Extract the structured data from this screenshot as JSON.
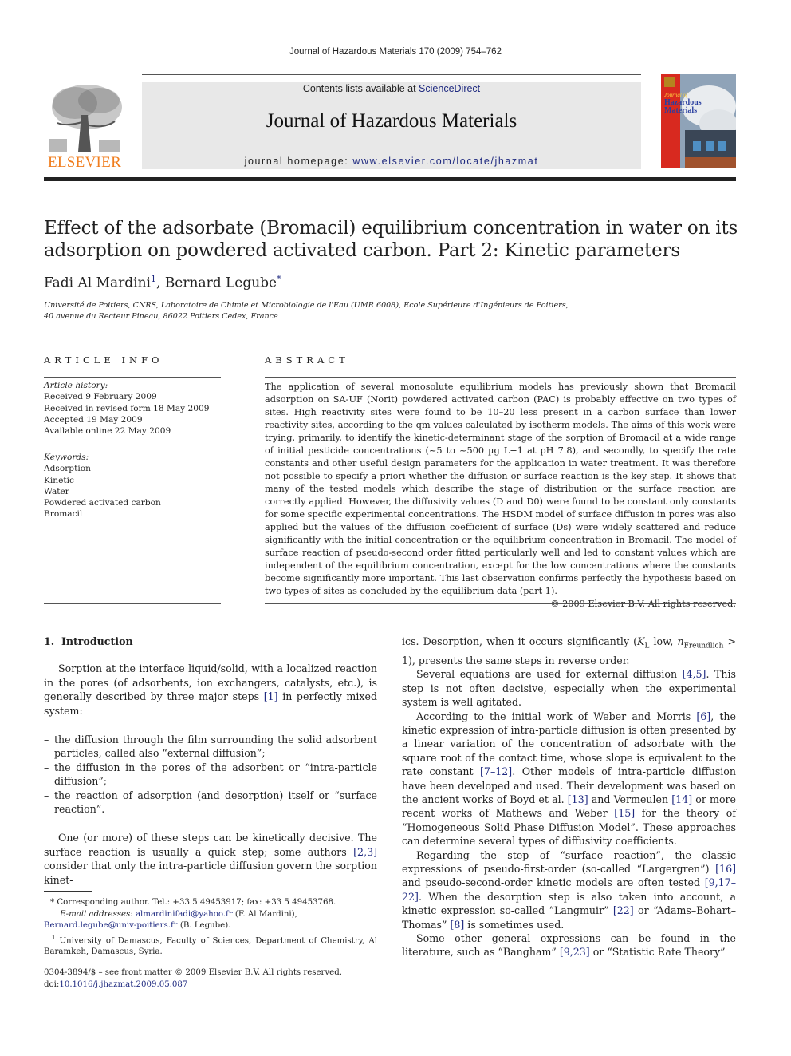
{
  "header": {
    "running_head": "Journal of Hazardous Materials 170 (2009) 754–762",
    "contents_prefix": "Contents lists available at ",
    "contents_link": "ScienceDirect",
    "journal_name": "Journal of Hazardous Materials",
    "homepage_prefix": "journal homepage: ",
    "homepage_link": "www.elsevier.com/locate/jhazmat",
    "publisher_logo_text": "ELSEVIER",
    "cover_title_line1": "Journal of",
    "cover_title_line2": "Hazardous",
    "cover_title_line3": "Materials"
  },
  "article": {
    "title": "Effect of the adsorbate (Bromacil) equilibrium concentration in water on its adsorption on powdered activated carbon. Part 2: Kinetic parameters",
    "authors": [
      {
        "name": "Fadi Al Mardini",
        "mark": "1"
      },
      {
        "name": "Bernard Legube",
        "mark": "*"
      }
    ],
    "author_separator": ", ",
    "affiliation_line1": "Université de Poitiers, CNRS, Laboratoire de Chimie et Microbiologie de l'Eau (UMR 6008), Ecole Supérieure d'Ingénieurs de Poitiers,",
    "affiliation_line2": "40 avenue du Recteur Pineau, 86022 Poitiers Cedex, France"
  },
  "article_info": {
    "heading": "ARTICLE INFO",
    "history_label": "Article history:",
    "history": [
      "Received 9 February 2009",
      "Received in revised form 18 May 2009",
      "Accepted 19 May 2009",
      "Available online 22 May 2009"
    ],
    "keywords_label": "Keywords:",
    "keywords": [
      "Adsorption",
      "Kinetic",
      "Water",
      "Powdered activated carbon",
      "Bromacil"
    ]
  },
  "abstract": {
    "heading": "ABSTRACT",
    "text": "The application of several monosolute equilibrium models has previously shown that Bromacil adsorption on SA-UF (Norit) powdered activated carbon (PAC) is probably effective on two types of sites. High reactivity sites were found to be 10–20 less present in a carbon surface than lower reactivity sites, according to the qm values calculated by isotherm models. The aims of this work were trying, primarily, to identify the kinetic-determinant stage of the sorption of Bromacil at a wide range of initial pesticide concentrations (~5 to ~500 µg L−1 at pH 7.8), and secondly, to specify the rate constants and other useful design parameters for the application in water treatment. It was therefore not possible to specify a priori whether the diffusion or surface reaction is the key step. It shows that many of the tested models which describe the stage of distribution or the surface reaction are correctly applied. However, the diffusivity values (D and D0) were found to be constant only constants for some specific experimental concentrations. The HSDM model of surface diffusion in pores was also applied but the values of the diffusion coefficient of surface (Ds) were widely scattered and reduce significantly with the initial concentration or the equilibrium concentration in Bromacil. The model of surface reaction of pseudo-second order fitted particularly well and led to constant values which are independent of the equilibrium concentration, except for the low concentrations where the constants become significantly more important. This last observation confirms perfectly the hypothesis based on two types of sites as concluded by the equilibrium data (part 1).",
    "copyright": "© 2009 Elsevier B.V. All rights reserved."
  },
  "introduction": {
    "heading_number": "1.",
    "heading": "Introduction",
    "para1_a": "Sorption at the interface liquid/solid, with a localized reaction in the pores (of adsorbents, ion exchangers, catalysts, etc.), is generally described by three major steps ",
    "para1_ref": "[1]",
    "para1_b": " in perfectly mixed system:",
    "steps": [
      "the diffusion through the film surrounding the solid adsorbent particles, called also “external diffusion”;",
      "the diffusion in the pores of the adsorbent or “intra-particle diffusion”;",
      "the reaction of adsorption (and desorption) itself or “surface reaction”."
    ],
    "para2_a": "One (or more) of these steps can be kinetically decisive. The surface reaction is usually a quick step; some authors ",
    "para2_ref": "[2,3]",
    "para2_b": " consider that only the intra-particle diffusion govern the sorption kinet-",
    "col2_para1_a": "ics. Desorption, when it occurs significantly (",
    "col2_para1_kl": "K",
    "col2_para1_kl_sub": "L",
    "col2_para1_mid": " low, ",
    "col2_para1_n": "n",
    "col2_para1_n_sub": "Freundlich",
    "col2_para1_b": " > 1), presents the same steps in reverse order.",
    "col2_para2_a": "Several equations are used for external diffusion ",
    "col2_para2_ref": "[4,5]",
    "col2_para2_b": ". This step is not often decisive, especially when the experimental system is well agitated.",
    "col2_para3_a": "According to the initial work of Weber and Morris ",
    "col2_para3_ref1": "[6]",
    "col2_para3_b": ", the kinetic expression of intra-particle diffusion is often presented by a linear variation of the concentration of adsorbate with the square root of the contact time, whose slope is equivalent to the rate constant ",
    "col2_para3_ref2": "[7–12]",
    "col2_para3_c": ". Other models of intra-particle diffusion have been developed and used. Their development was based on the ancient works of Boyd et al. ",
    "col2_para3_ref3": "[13]",
    "col2_para3_d": " and Vermeulen ",
    "col2_para3_ref4": "[14]",
    "col2_para3_e": " or more recent works of Mathews and Weber ",
    "col2_para3_ref5": "[15]",
    "col2_para3_f": " for the theory of “Homogeneous Solid Phase Diffusion Model”. These approaches can determine several types of diffusivity coefficients.",
    "col2_para4_a": "Regarding the step of “surface reaction”, the classic expressions of pseudo-first-order (so-called “Largergren”) ",
    "col2_para4_ref1": "[16]",
    "col2_para4_b": " and pseudo-second-order kinetic models are often tested ",
    "col2_para4_ref2": "[9,17–22]",
    "col2_para4_c": ". When the desorption step is also taken into account, a kinetic expression so-called “Langmuir” ",
    "col2_para4_ref3": "[22]",
    "col2_para4_d": " or “Adams–Bohart–Thomas” ",
    "col2_para4_ref4": "[8]",
    "col2_para4_e": " is sometimes used.",
    "col2_para5_a": "Some other general expressions can be found in the literature, such as “Bangham” ",
    "col2_para5_ref": "[9,23]",
    "col2_para5_b": " or “Statistic Rate Theory”"
  },
  "footnotes": {
    "corresponding": "*  Corresponding author. Tel.: +33 5 49453917; fax: +33 5 49453768.",
    "email_label": "E-mail addresses: ",
    "email1": "almardinifadi@yahoo.fr",
    "email1_owner": " (F. Al Mardini),",
    "email2": "Bernard.legube@univ-poitiers.fr",
    "email2_owner": " (B. Legube).",
    "fn1_mark": "1",
    "fn1": " University of Damascus, Faculty of Sciences, Department of Chemistry, Al Baramkeh, Damascus, Syria."
  },
  "front_matter": {
    "issn_line": "0304-3894/$ – see front matter © 2009 Elsevier B.V. All rights reserved.",
    "doi_label": "doi:",
    "doi": "10.1016/j.jhazmat.2009.05.087"
  },
  "colors": {
    "link": "#1f2a80",
    "elsevier_orange": "#f07d1e",
    "masthead_bg": "#e8e8e8",
    "cover_red": "#d8291f"
  }
}
